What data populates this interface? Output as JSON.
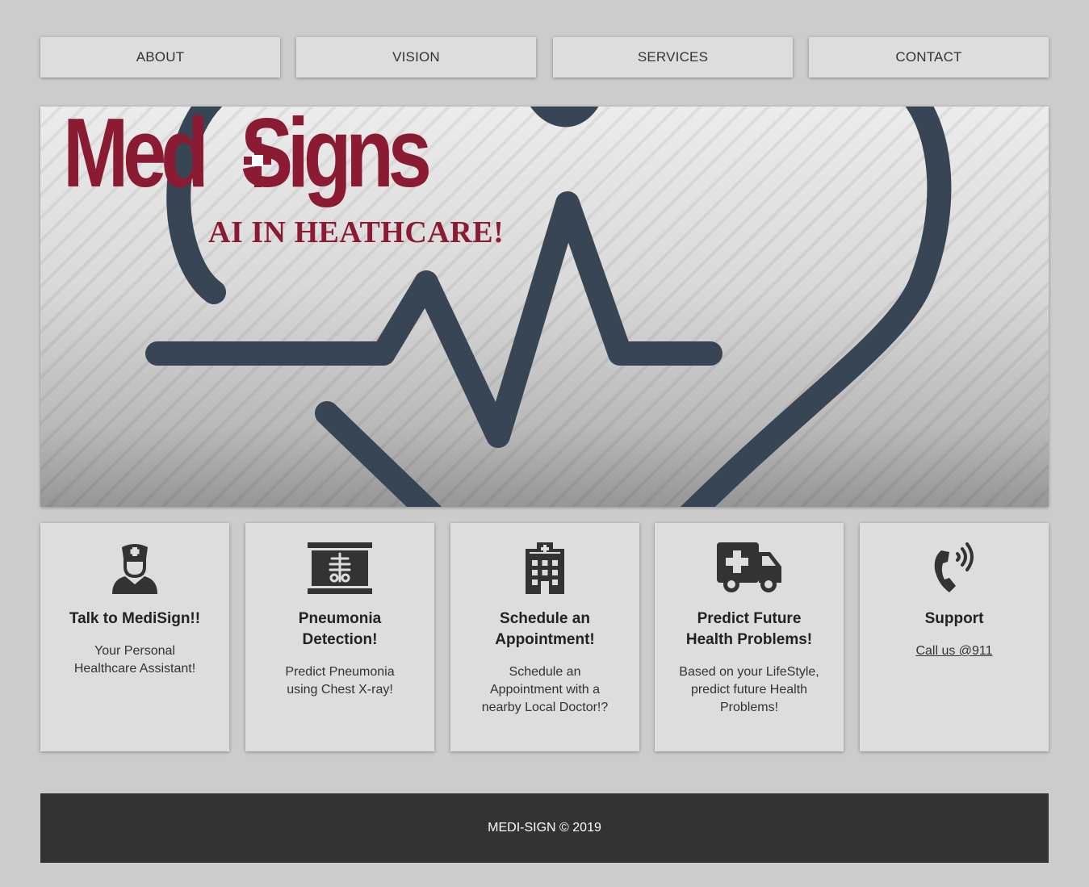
{
  "nav": {
    "items": [
      {
        "label": "ABOUT"
      },
      {
        "label": "VISION"
      },
      {
        "label": "SERVICES"
      },
      {
        "label": "CONTACT"
      }
    ]
  },
  "hero": {
    "logo_text_left": "Med",
    "logo_text_right": "Signs",
    "tagline": "AI IN HEATHCARE!",
    "logo_color": "#8b1a33",
    "art_color": "#384554"
  },
  "cards": [
    {
      "icon": "nurse-icon",
      "title": "Talk to MediSign!!",
      "text": "Your Personal Healthcare Assistant!"
    },
    {
      "icon": "xray-icon",
      "title": "Pneumonia Detection!",
      "text": "Predict Pneumonia using Chest X-ray!"
    },
    {
      "icon": "hospital-icon",
      "title": "Schedule an Appointment!",
      "text": "Schedule an Appointment with a nearby Local Doctor!?"
    },
    {
      "icon": "ambulance-icon",
      "title": "Predict Future Health Problems!",
      "text": "Based on your LifeStyle, predict future Health Problems!"
    },
    {
      "icon": "phone-volume-icon",
      "title": "Support",
      "link": "Call us @911"
    }
  ],
  "footer": {
    "text": "MEDI-SIGN © 2019"
  }
}
